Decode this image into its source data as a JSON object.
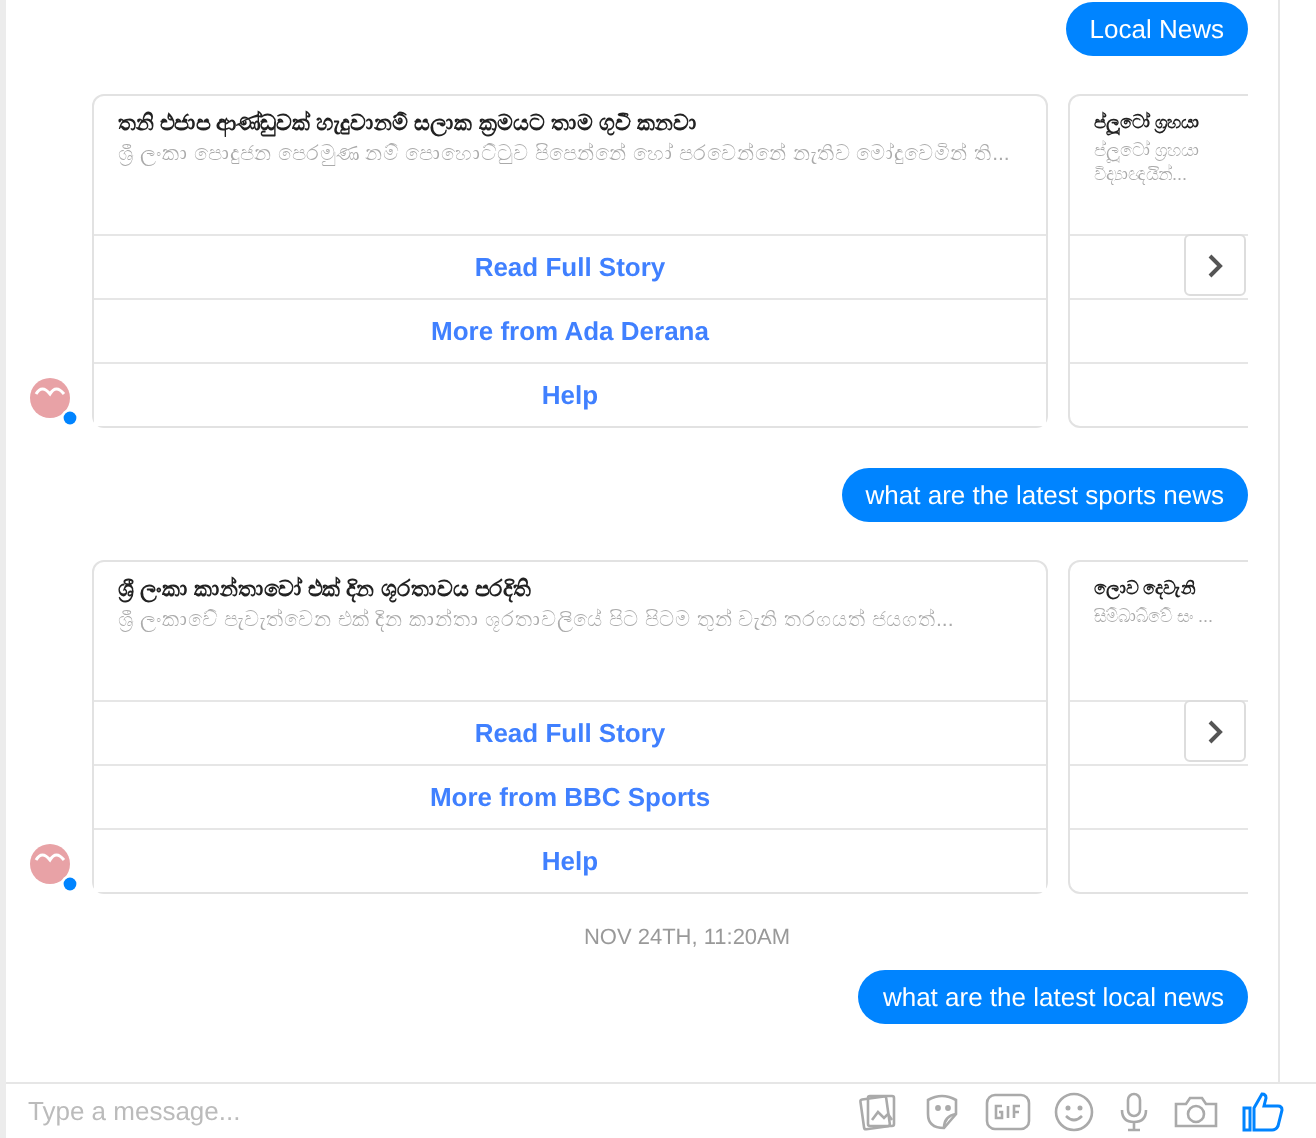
{
  "messages": [
    {
      "kind": "outgoing",
      "text": "Local News"
    },
    {
      "kind": "carousel",
      "cards": [
        {
          "title": "තනි එජාප ආණ්ඩුවක් හැදුවානම් සලාක ක්‍රමයට තාම ගුවී කනවා",
          "subtitle": "ශ්‍රී ලංකා පොදුජන පෙරමුණ නම් පොහොට්ටුව පිපෙන්නේ හෝ පරවෙන්නේ නැතිව මෝදුවෙමින් ති...",
          "buttons": [
            "Read Full Story",
            "More from Ada Derana",
            "Help"
          ]
        },
        {
          "title": "ප්ලූටෝ ග්‍රහයා",
          "subtitle": "ප්ලූටෝ ග්‍රහයා විද්‍යාඥයින්..."
        }
      ]
    },
    {
      "kind": "outgoing",
      "text": "what are the latest sports news"
    },
    {
      "kind": "carousel",
      "cards": [
        {
          "title": "ශ්‍රී ලංකා කාන්තාවෝ එක් දින ශූරතාවය පරදිති",
          "subtitle": "ශ්‍රී ලංකාවේ පැවැත්වෙන එක් දින කාන්තා ශූරතාවලියේ පිට පිටම තුන් වැනි තරගයත් ජයගත්...",
          "buttons": [
            "Read Full Story",
            "More from BBC Sports",
            "Help"
          ]
        },
        {
          "title": "ලොව දෙවැනි",
          "subtitle": "සිම්බාබ්වේ සං ..."
        }
      ]
    },
    {
      "kind": "timestamp",
      "text": "NOV 24TH, 11:20AM"
    },
    {
      "kind": "outgoing",
      "text": "what are the latest local news"
    }
  ],
  "composer": {
    "placeholder": "Type a message..."
  }
}
